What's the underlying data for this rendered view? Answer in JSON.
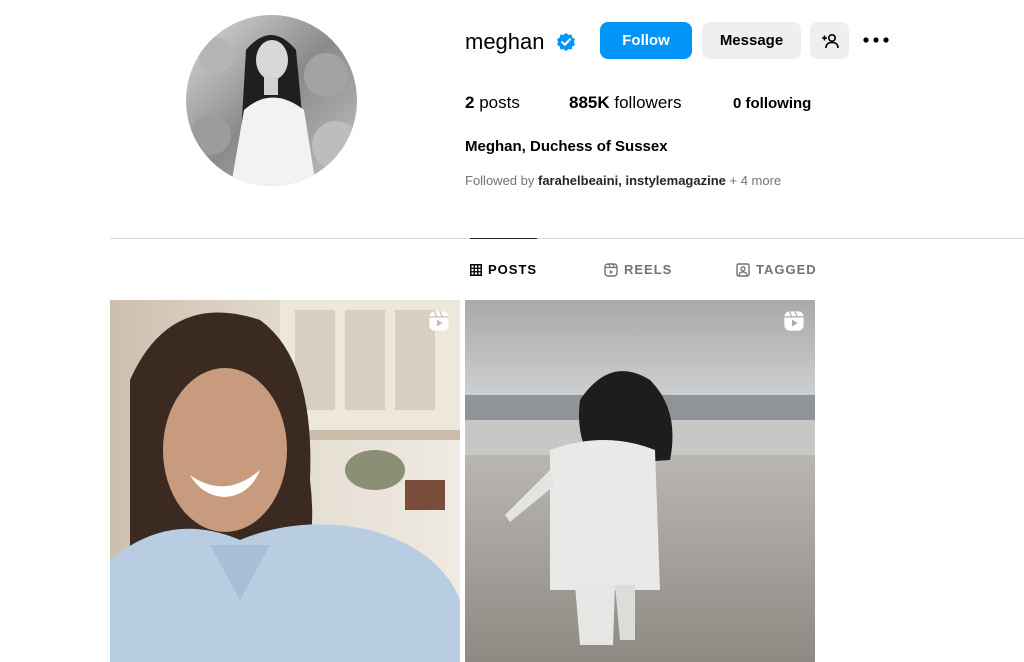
{
  "profile": {
    "username": "meghan",
    "full_name": "Meghan, Duchess of Sussex",
    "avatar_icon": "profile-photo",
    "verified_icon": "verified-badge-icon"
  },
  "actions": {
    "follow_label": "Follow",
    "message_label": "Message",
    "suggest_icon": "add-person-icon",
    "more_icon": "more-options-icon"
  },
  "stats": {
    "posts_count": "2",
    "posts_label": "posts",
    "followers_count": "885K",
    "followers_label": "followers",
    "following_count": "0",
    "following_label": "following"
  },
  "followed_by": {
    "prefix": "Followed by",
    "accounts": [
      "farahelbeaini",
      "instylemagazine"
    ],
    "separator": ",",
    "more": "+ 4 more"
  },
  "tabs": [
    {
      "label": "POSTS",
      "icon": "grid-icon",
      "active": true
    },
    {
      "label": "REELS",
      "icon": "reels-icon",
      "active": false
    },
    {
      "label": "TAGGED",
      "icon": "tagged-icon",
      "active": false
    }
  ],
  "posts": [
    {
      "type": "reel",
      "icon": "reel-icon"
    },
    {
      "type": "reel",
      "icon": "reel-icon"
    }
  ],
  "colors": {
    "accent": "#0095f6",
    "verified": "#0095f6",
    "secondary_button": "#efefef",
    "muted_text": "#737373",
    "divider": "#dbdbdb"
  }
}
